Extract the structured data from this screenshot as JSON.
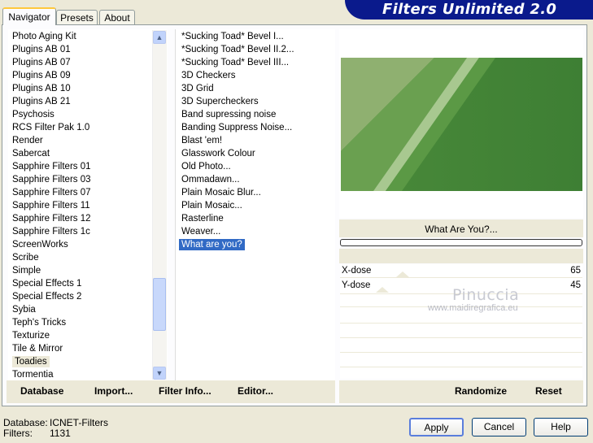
{
  "tabs": [
    {
      "label": "Navigator"
    },
    {
      "label": "Presets"
    },
    {
      "label": "About"
    }
  ],
  "brand_title": "Filters Unlimited 2.0",
  "categories": [
    "Photo Aging Kit",
    "Plugins AB 01",
    "Plugins AB 07",
    "Plugins AB 09",
    "Plugins AB 10",
    "Plugins AB 21",
    "Psychosis",
    "RCS Filter Pak 1.0",
    "Render",
    "Sabercat",
    "Sapphire Filters 01",
    "Sapphire Filters 03",
    "Sapphire Filters 07",
    "Sapphire Filters 11",
    "Sapphire Filters 12",
    "Sapphire Filters 1c",
    "ScreenWorks",
    "Scribe",
    "Simple",
    "Special Effects 1",
    "Special Effects 2",
    "Sybia",
    "Teph's Tricks",
    "Texturize",
    "Tile & Mirror",
    "Toadies",
    "Tormentia"
  ],
  "selected_category": "Toadies",
  "filters": [
    "*Sucking Toad*  Bevel I...",
    "*Sucking Toad*  Bevel II.2...",
    "*Sucking Toad*  Bevel III...",
    "3D Checkers",
    "3D Grid",
    "3D Supercheckers",
    "Band supressing noise",
    "Banding Suppress Noise...",
    "Blast 'em!",
    "Glasswork Colour",
    "Old Photo...",
    "Ommadawn...",
    "Plain Mosaic Blur...",
    "Plain Mosaic...",
    "Rasterline",
    "Weaver...",
    "What are you?"
  ],
  "selected_filter": "What are you?",
  "filter_name": "What Are You?...",
  "params": [
    {
      "label": "X-dose",
      "value": "65"
    },
    {
      "label": "Y-dose",
      "value": "45"
    }
  ],
  "watermark": {
    "name": "Pinuccia",
    "url": "www.maidiregrafica.eu"
  },
  "bottom_left_buttons": {
    "database": "Database",
    "import": "Import...",
    "filter_info": "Filter Info...",
    "editor": "Editor..."
  },
  "bottom_right_buttons": {
    "randomize": "Randomize",
    "reset": "Reset"
  },
  "status": {
    "database_label": "Database:",
    "database_value": "ICNET-Filters",
    "filters_label": "Filters:",
    "filters_value": "1131"
  },
  "dialog_buttons": {
    "apply": "Apply",
    "cancel": "Cancel",
    "help": "Help"
  },
  "colors": {
    "banner": "#0a1a8c",
    "selection": "#316ac5",
    "preview_green": "#4e8c3e"
  }
}
